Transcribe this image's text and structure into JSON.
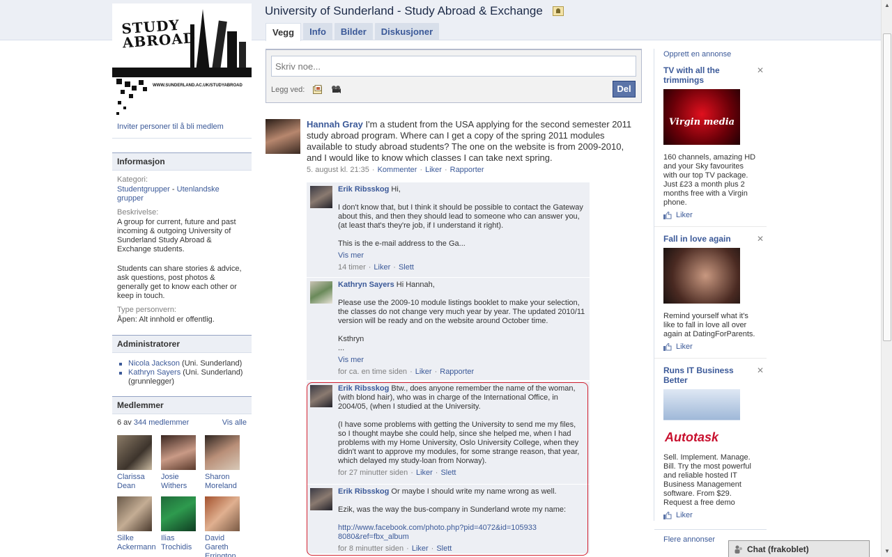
{
  "page": {
    "title": "University of Sunderland - Study Abroad & Exchange",
    "tabs": [
      {
        "label": "Vegg"
      },
      {
        "label": "Info"
      },
      {
        "label": "Bilder"
      },
      {
        "label": "Diskusjoner"
      }
    ]
  },
  "left": {
    "logo_text": "STUDY ABROAD",
    "logo_url": "WWW.SUNDERLAND.AC.UK/STUDYABROAD",
    "invite": "Inviter personer til å bli medlem",
    "info": {
      "heading": "Informasjon",
      "category_label": "Kategori:",
      "category_link1": "Studentgrupper",
      "category_sep": " - ",
      "category_link2": "Utenlandske grupper",
      "description_label": "Beskrivelse:",
      "description_p1": "A group for current, future and past incoming & outgoing University of Sunderland Study Abroad & Exchange students.",
      "description_p2": "Students can share stories & advice, ask questions, post photos & generally get to know each other or keep in touch.",
      "privacy_label": "Type personvern:",
      "privacy_value": "Åpen: Alt innhold er offentlig."
    },
    "admins": {
      "heading": "Administratorer",
      "list": [
        {
          "name": "Nicola Jackson",
          "suffix": " (Uni. Sunderland)"
        },
        {
          "name": "Kathryn Sayers",
          "suffix": " (Uni. Sunderland) (grunnlegger)"
        }
      ]
    },
    "members": {
      "heading": "Medlemmer",
      "count_prefix": "6 av ",
      "count_link": "344 medlemmer",
      "see_all": "Vis alle",
      "list": [
        {
          "name": "Clarissa Dean"
        },
        {
          "name": "Josie Withers"
        },
        {
          "name": "Sharon Moreland"
        },
        {
          "name": "Silke Ackermann"
        },
        {
          "name": "Ilias Trochidis"
        },
        {
          "name": "David Gareth Errington"
        }
      ]
    }
  },
  "composer": {
    "placeholder": "Skriv noe...",
    "attach_label": "Legg ved:",
    "share_label": "Del"
  },
  "post": {
    "author": "Hannah Gray",
    "text": " I'm a student from the USA applying for the second semester 2011 study abroad program. Where can I get a copy of the spring 2011 modules available to study abroad students? The one on the website is from 2009-2010, and I would like to know which classes I can take next spring.",
    "time": "5. august kl. 21:35",
    "comment_label": "Kommenter",
    "like_label": "Liker",
    "report_label": "Rapporter"
  },
  "comments": [
    {
      "author": "Erik Ribsskog",
      "first": " Hi,",
      "paras": [
        "I don't know that, but I think it should be possible to contact the Gateway about this, and then they should lead to someone who can answer you, (at least that's they're job, if I understand it right).",
        "This is the e-mail address to the Ga..."
      ],
      "more": "Vis mer",
      "time": "14 timer",
      "actions": [
        "Liker",
        "Slett"
      ]
    },
    {
      "author": "Kathryn Sayers",
      "first": " Hi Hannah,",
      "paras": [
        "Please use the 2009-10 module listings booklet to make your selection, the classes do not change very much year by year. The updated 2010/11 version will be ready and on the website around October time.",
        "Ksthryn\n..."
      ],
      "more": "Vis mer",
      "time": "for ca. en time siden",
      "actions": [
        "Liker",
        "Rapporter"
      ]
    },
    {
      "author": "Erik Ribsskog",
      "first": " Btw., does anyone remember the name of the woman, (with blond hair), who was in charge of the International Office, in 2004/05, (when I studied at the University.",
      "paras": [
        "(I have some problems with getting the University to send me my files, so I thought maybe she could help, since she helped me, when I had problems with my Home University, Oslo University College, when they didn't want to approve my modules, for some strange reason, that year, which delayed my study-loan from Norway)."
      ],
      "more": "",
      "time": "for 27 minutter siden",
      "actions": [
        "Liker",
        "Slett"
      ]
    },
    {
      "author": "Erik Ribsskog",
      "first": " Or maybe I should write my name wrong as well.",
      "paras": [
        "Ezik, was the way the bus-company in Sunderland wrote my name:"
      ],
      "link": "http://www.facebook.com/photo.php?pid=4072&id=105933 8080&ref=fbx_album",
      "more": "",
      "time": "for 8 minutter siden",
      "actions": [
        "Liker",
        "Slett"
      ]
    }
  ],
  "ads": {
    "create": "Opprett en annonse",
    "items": [
      {
        "title": "TV with all the trimmings",
        "brand": "Virgin media",
        "text": "160 channels, amazing HD and your Sky favourites with our top TV package. Just £23 a month plus 2 months free with a Virgin phone.",
        "like": "Liker"
      },
      {
        "title": "Fall in love again",
        "text": "Remind yourself what it's like to fall in love all over again at DatingForParents.",
        "like": "Liker"
      },
      {
        "title": "Runs IT Business Better",
        "brand": "Autotask",
        "text": "Sell. Implement. Manage. Bill. Try the most powerful and reliable hosted IT Business Management software. From $29. Request a free demo",
        "like": "Liker"
      }
    ],
    "more": "Flere annonser"
  },
  "chat": {
    "label": "Chat (frakoblet)"
  },
  "colors": {
    "link": "#3b5998",
    "highlight": "#d2202f",
    "comment_bg": "#edeff4"
  }
}
